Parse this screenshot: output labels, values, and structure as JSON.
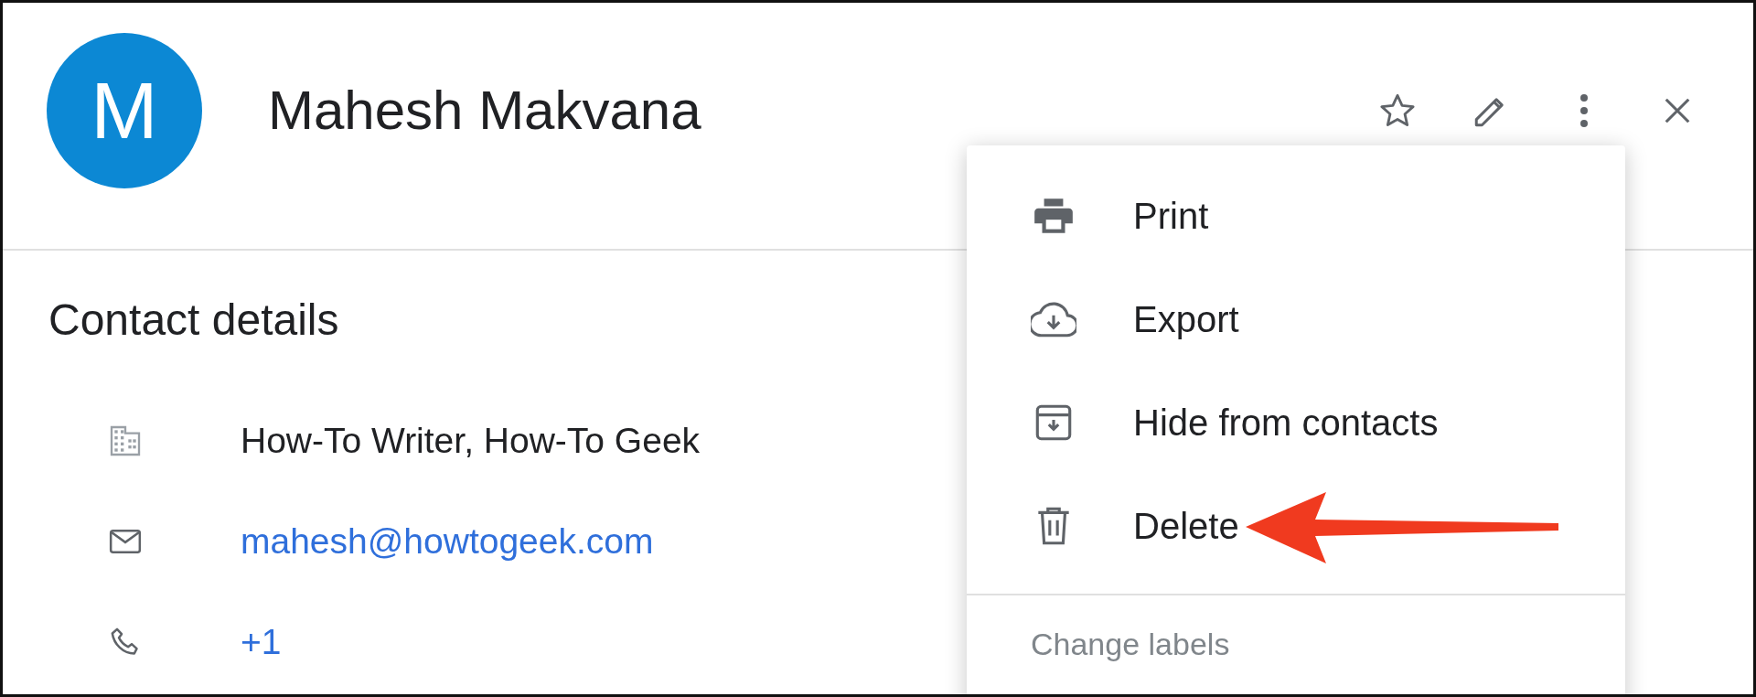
{
  "contact": {
    "initial": "M",
    "name": "Mahesh Makvana",
    "starred": false
  },
  "header_actions": [
    {
      "kind": "star"
    },
    {
      "kind": "edit"
    },
    {
      "kind": "more"
    },
    {
      "kind": "close"
    }
  ],
  "details": {
    "title": "Contact details",
    "rows": [
      {
        "kind": "work",
        "text": "How-To Writer, How-To Geek",
        "link": false
      },
      {
        "kind": "email",
        "text": "mahesh@howtogeek.com",
        "link": true
      },
      {
        "kind": "phone",
        "text": "+1",
        "link": true
      }
    ]
  },
  "menu": {
    "items": [
      {
        "kind": "print",
        "label": "Print"
      },
      {
        "kind": "export",
        "label": "Export"
      },
      {
        "kind": "hide",
        "label": "Hide from contacts"
      },
      {
        "kind": "delete",
        "label": "Delete",
        "pointed": true
      }
    ],
    "section_label": "Change labels"
  }
}
